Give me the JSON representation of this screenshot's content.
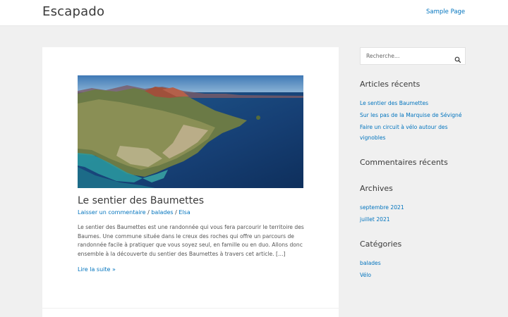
{
  "header": {
    "site_title": "Escapado",
    "nav": [
      {
        "label": "Sample Page"
      }
    ]
  },
  "post": {
    "title": "Le sentier des Baumettes",
    "meta": {
      "comment_link": "Laisser un commentaire",
      "sep": "/",
      "category": "balades",
      "author": "Elsa"
    },
    "excerpt": "Le sentier des Baumettes est une randonnée qui vous fera parcourir le territoire des Baumes. Une commune située dans le creux des roches qui offre un parcours de randonnée facile à pratiquer que vous soyez seul, en famille ou en duo. Allons donc ensemble à la découverte du sentier des Baumettes à travers cet article. […]",
    "read_more": "Lire la suite »"
  },
  "sidebar": {
    "search": {
      "placeholder": "Recherche…"
    },
    "recent_posts": {
      "title": "Articles récents",
      "items": [
        "Le sentier des Baumettes",
        "Sur les pas de la Marquise de Sévigné",
        "Faire un circuit à vélo autour des vignobles"
      ]
    },
    "recent_comments": {
      "title": "Commentaires récents"
    },
    "archives": {
      "title": "Archives",
      "items": [
        "septembre 2021",
        "juillet 2021"
      ]
    },
    "categories": {
      "title": "Catégories",
      "items": [
        "balades",
        "Vélo"
      ]
    }
  },
  "colors": {
    "link": "#0274be",
    "background": "#f0f0f0",
    "card": "#ffffff",
    "text": "#3a3a3a"
  }
}
